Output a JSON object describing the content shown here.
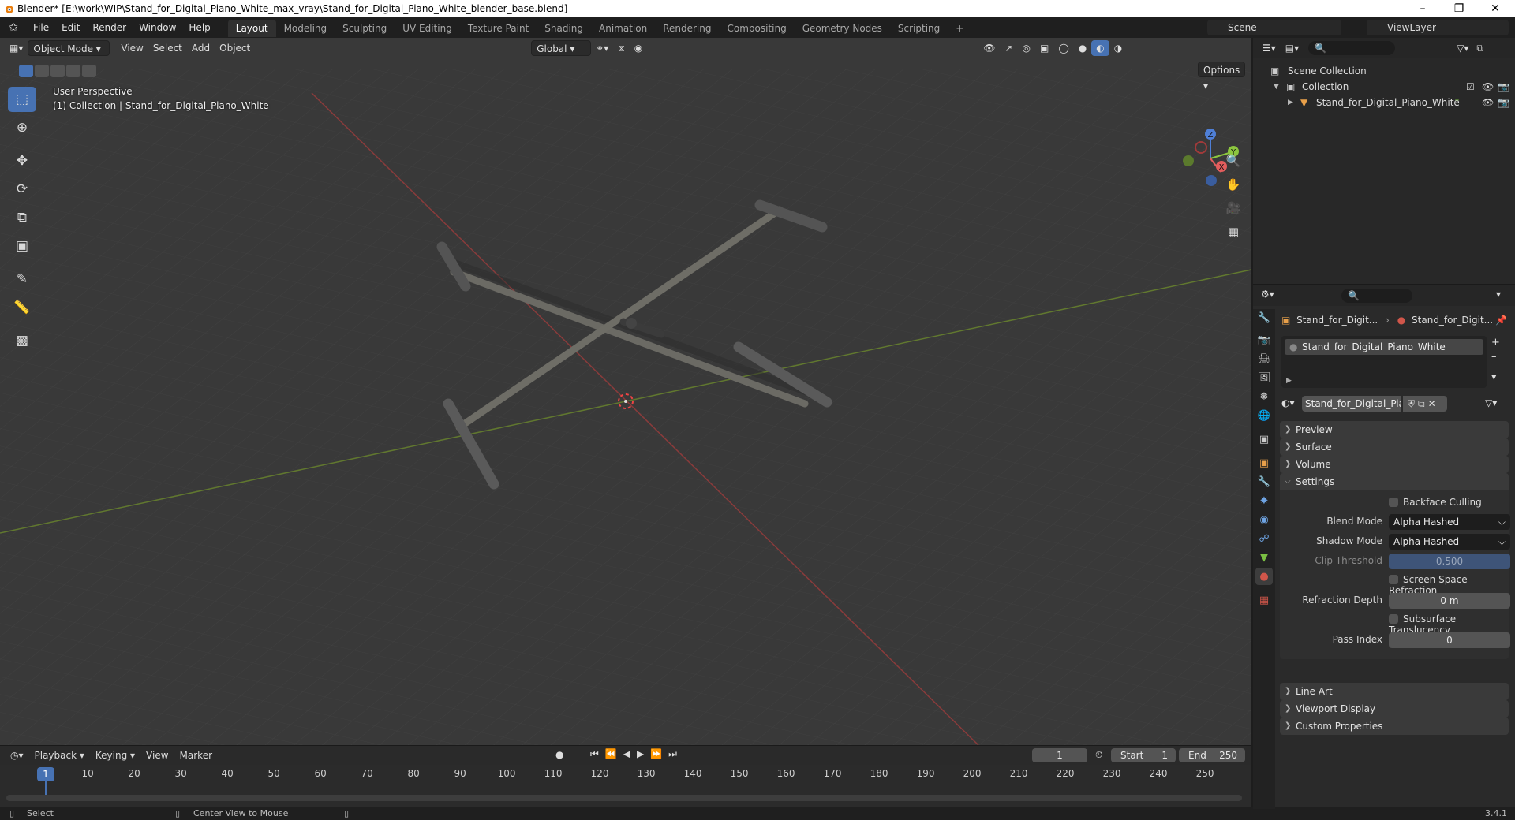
{
  "window": {
    "title": "Blender* [E:\\work\\WIP\\Stand_for_Digital_Piano_White_max_vray\\Stand_for_Digital_Piano_White_blender_base.blend]"
  },
  "menu": {
    "items": [
      "File",
      "Edit",
      "Render",
      "Window",
      "Help"
    ]
  },
  "workspaces": {
    "tabs": [
      "Layout",
      "Modeling",
      "Sculpting",
      "UV Editing",
      "Texture Paint",
      "Shading",
      "Animation",
      "Rendering",
      "Compositing",
      "Geometry Nodes",
      "Scripting"
    ],
    "active": "Layout",
    "add_label": "+"
  },
  "scene": {
    "name": "Scene",
    "view_layer": "ViewLayer"
  },
  "viewport": {
    "mode": "Object Mode",
    "menus": [
      "View",
      "Select",
      "Add",
      "Object"
    ],
    "orientation": "Global",
    "options_label": "Options",
    "perspective_label": "User Perspective",
    "collection_label": "(1) Collection | Stand_for_Digital_Piano_White",
    "gizmo": {
      "z": "Z",
      "y": "Y",
      "x": "X"
    }
  },
  "outliner": {
    "scene_collection": "Scene Collection",
    "collection": "Collection",
    "object": "Stand_for_Digital_Piano_White"
  },
  "properties": {
    "breadcrumb_object": "Stand_for_Digit...",
    "breadcrumb_material": "Stand_for_Digit...",
    "material_slot": "Stand_for_Digital_Piano_White",
    "material_name": "Stand_for_Digital_Piano_W...",
    "panels": {
      "preview": "Preview",
      "surface": "Surface",
      "volume": "Volume",
      "settings": "Settings",
      "line_art": "Line Art",
      "viewport_display": "Viewport Display",
      "custom_properties": "Custom Properties"
    },
    "settings": {
      "backface_culling": "Backface Culling",
      "blend_mode_label": "Blend Mode",
      "blend_mode_value": "Alpha Hashed",
      "shadow_mode_label": "Shadow Mode",
      "shadow_mode_value": "Alpha Hashed",
      "clip_threshold_label": "Clip Threshold",
      "clip_threshold_value": "0.500",
      "screen_space_refraction": "Screen Space Refraction",
      "refraction_depth_label": "Refraction Depth",
      "refraction_depth_value": "0 m",
      "subsurface_translucency": "Subsurface Translucency",
      "pass_index_label": "Pass Index",
      "pass_index_value": "0"
    }
  },
  "timeline": {
    "menus": [
      "Playback",
      "Keying",
      "View",
      "Marker"
    ],
    "current_frame": "1",
    "start_label": "Start",
    "start_value": "1",
    "end_label": "End",
    "end_value": "250",
    "ruler_ticks": [
      "1",
      "10",
      "20",
      "30",
      "40",
      "50",
      "60",
      "70",
      "80",
      "90",
      "100",
      "110",
      "120",
      "130",
      "140",
      "150",
      "160",
      "170",
      "180",
      "190",
      "200",
      "210",
      "220",
      "230",
      "240",
      "250"
    ]
  },
  "statusbar": {
    "select": "Select",
    "center_view": "Center View to Mouse",
    "version": "3.4.1"
  }
}
